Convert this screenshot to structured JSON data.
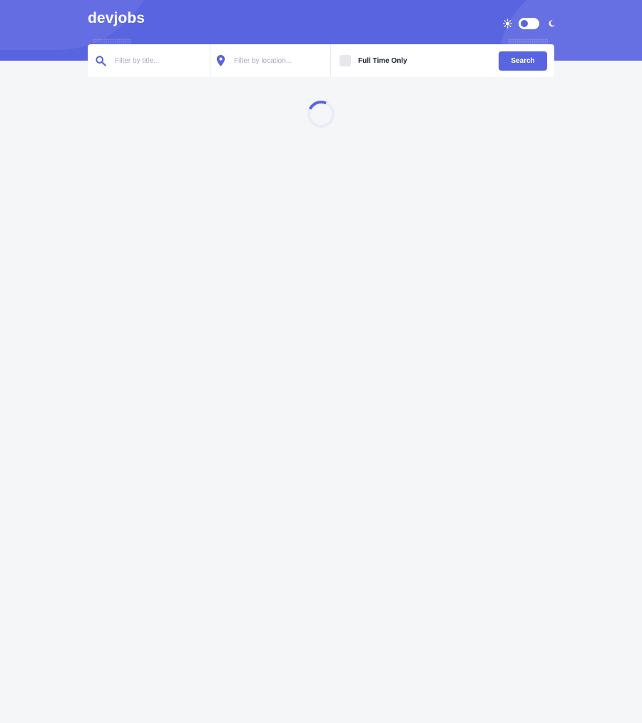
{
  "header": {
    "logo": "devjobs"
  },
  "theme": {
    "sun_icon": "sun-icon",
    "moon_icon": "moon-icon",
    "mode": "light"
  },
  "search": {
    "title_placeholder": "Filter by title...",
    "location_placeholder": "Filter by location...",
    "fulltime_label": "Full Time Only",
    "fulltime_checked": false,
    "button_label": "Search"
  },
  "status": {
    "loading": true,
    "indicator": "loading-spinner"
  },
  "colors": {
    "brand": "#5964e0",
    "background": "#f4f6f8",
    "text": "#19202d",
    "placeholder": "#a7adb8"
  }
}
